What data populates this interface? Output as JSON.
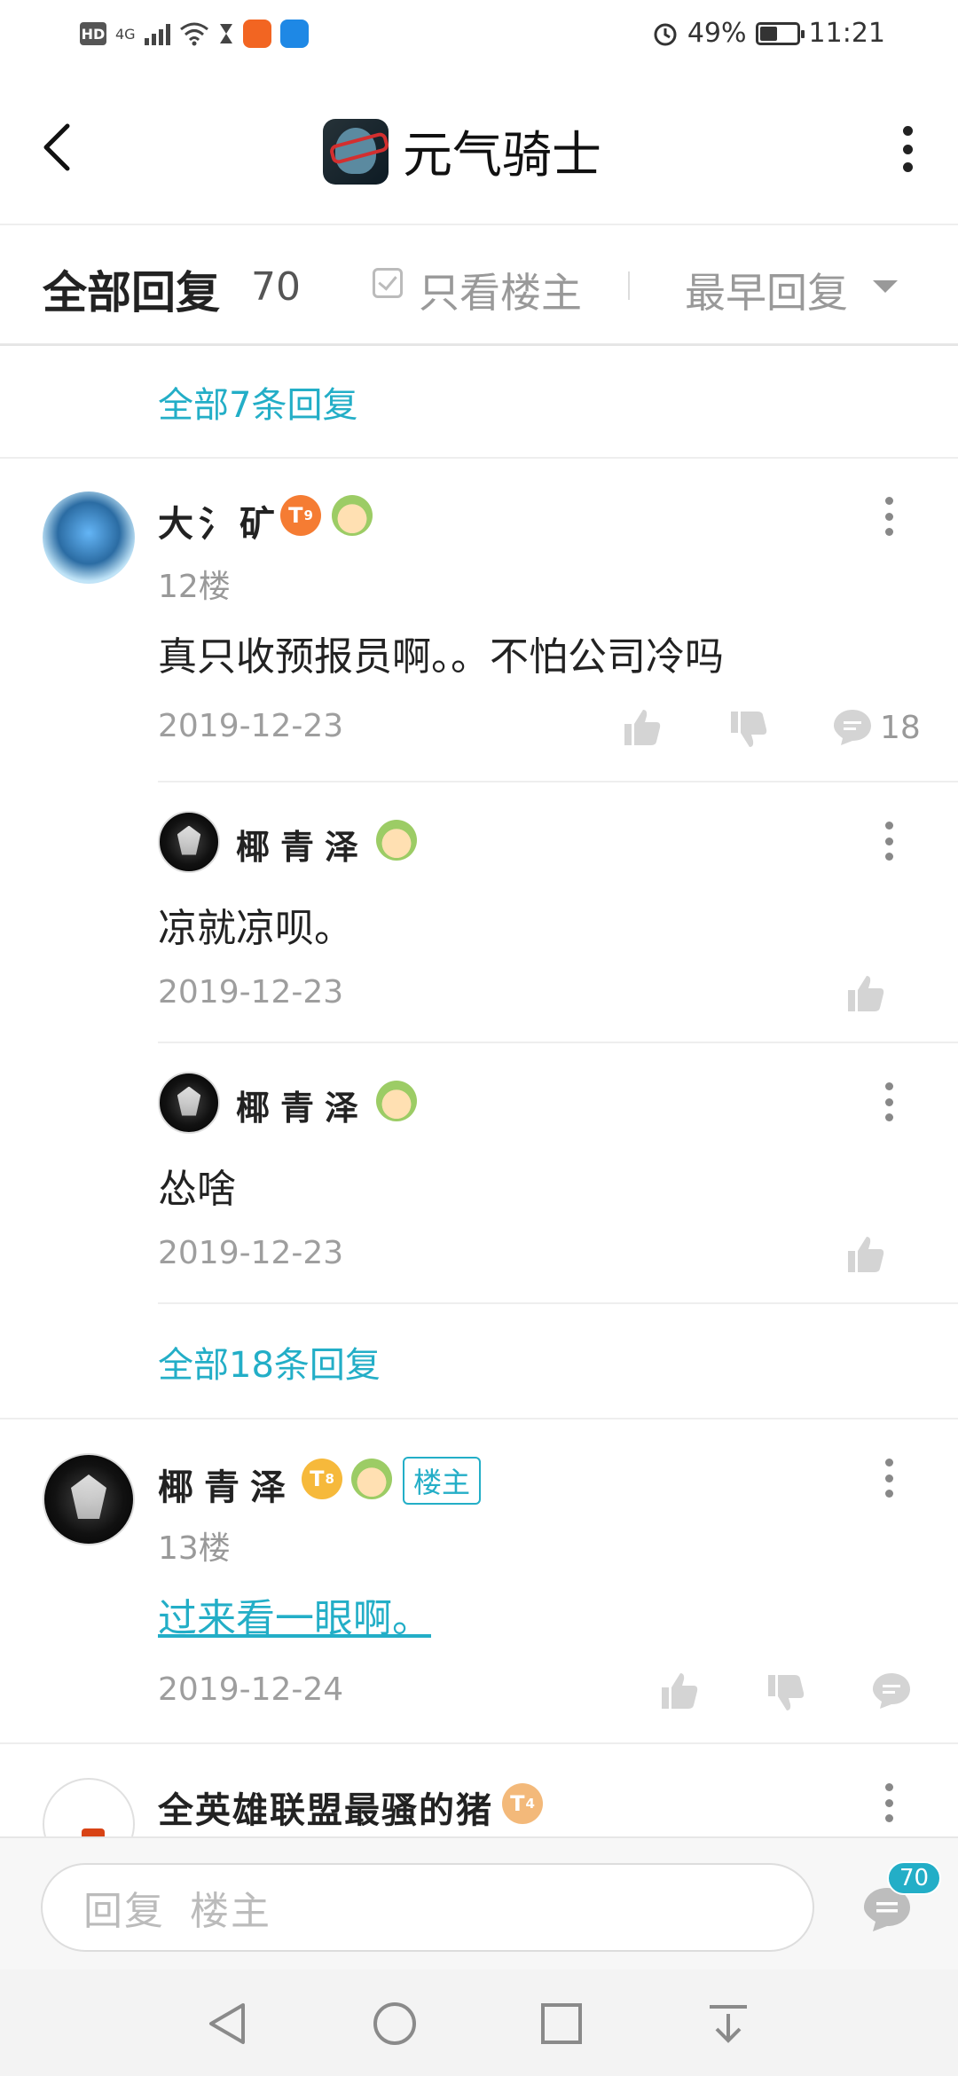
{
  "status_bar": {
    "hd": "HD",
    "network": "4G",
    "battery": "49%",
    "battery_level": 0.49,
    "time": "11:21"
  },
  "header": {
    "title": "元气骑士",
    "back_icon": "chevron-left-icon",
    "more_icon": "more-vertical-icon"
  },
  "filter": {
    "all_replies": "全部回复",
    "count": "70",
    "only_op": "只看楼主",
    "sort": "最早回复"
  },
  "top_more": "全部7条回复",
  "posts": [
    {
      "username": "大氵矿",
      "level": "T",
      "level_sub": "9",
      "floor": "12楼",
      "content": "真只收预报员啊。。不怕公司冷吗",
      "date": "2019-12-23",
      "comment_count": "18",
      "replies": [
        {
          "username": "椰青泽",
          "content": "凉就凉呗。",
          "date": "2019-12-23"
        },
        {
          "username": "椰青泽",
          "content": "怂啥",
          "date": "2019-12-23"
        }
      ],
      "more_replies": "全部18条回复"
    },
    {
      "username": "椰青泽",
      "level": "T",
      "level_sub": "8",
      "owner_badge": "楼主",
      "floor": "13楼",
      "content": "过来看一眼啊。",
      "date": "2019-12-24"
    },
    {
      "username": "全英雄联盟最骚的猪",
      "level": "T",
      "level_sub": "4"
    }
  ],
  "reply_bar": {
    "placeholder_1": "回复",
    "placeholder_2": "楼主",
    "badge": "70"
  },
  "colors": {
    "accent": "#23aec7",
    "muted": "#999999"
  }
}
